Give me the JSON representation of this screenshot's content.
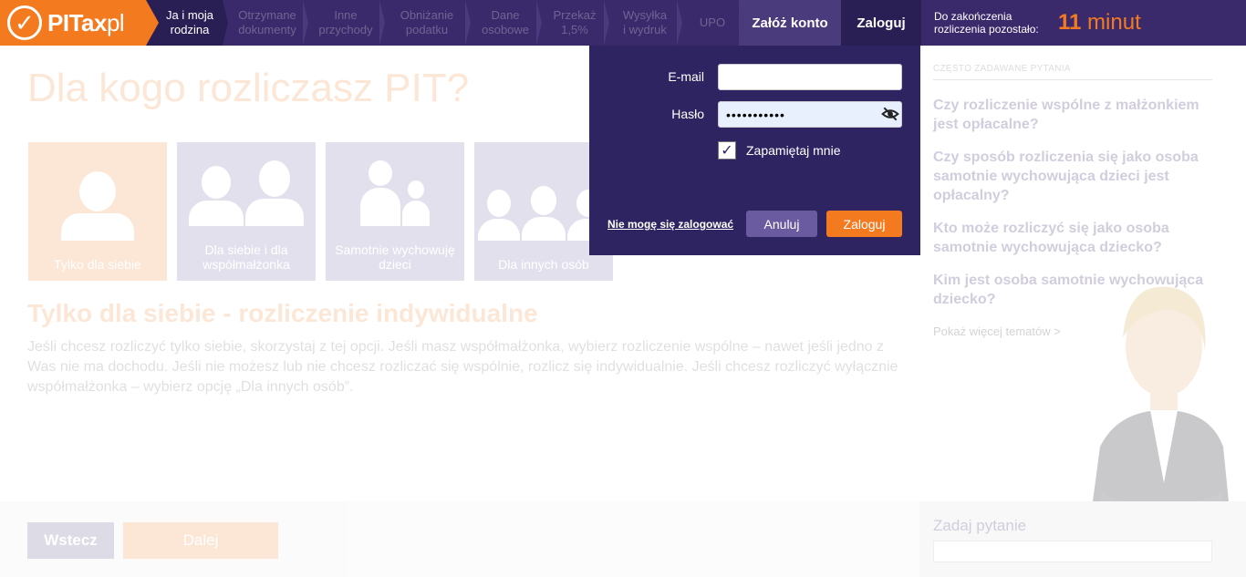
{
  "brand": {
    "name": "PITax",
    "suffix": "pl",
    "accent": "#f47a20",
    "primary": "#3b2a6b"
  },
  "nav": {
    "steps": [
      {
        "label": "Ja i moja rodzina",
        "active": true
      },
      {
        "label": "Otrzymane dokumenty"
      },
      {
        "label": "Inne przychody"
      },
      {
        "label": "Obniżanie podatku"
      },
      {
        "label": "Dane osobowe"
      },
      {
        "label": "Przekaż 1,5%"
      },
      {
        "label": "Wysyłka i wydruk"
      },
      {
        "label": "UPO"
      }
    ],
    "register_label": "Załóż konto",
    "login_label": "Zaloguj",
    "timer_label": "Do zakończenia rozliczenia pozostało:",
    "timer_value": "11",
    "timer_unit": "minut"
  },
  "main": {
    "title": "Dla kogo rozliczasz PIT?",
    "options": [
      {
        "label": "Tylko dla siebie",
        "icon": "single-person-icon",
        "selected": true
      },
      {
        "label": "Dla siebie i dla współmałżonka",
        "icon": "couple-icon"
      },
      {
        "label": "Samotnie wychowuję dzieci",
        "icon": "parent-child-icon"
      },
      {
        "label": "Dla innych osób",
        "icon": "group-icon"
      }
    ],
    "section_title": "Tylko dla siebie - rozliczenie indywidualne",
    "description": "Jeśli chcesz rozliczyć tylko siebie, skorzystaj z tej opcji. Jeśli masz współmałżonka, wybierz rozliczenie wspólne – nawet jeśli jedno z Was nie ma dochodu. Jeśli nie możesz lub nie chcesz rozliczać się wspólnie, rozlicz się indywidualnie. Jeśli chcesz rozliczyć wyłącznie współmałżonka – wybierz opcję „Dla innych osób”.",
    "back_label": "Wstecz",
    "next_label": "Dalej"
  },
  "sidebar": {
    "faq_heading": "Często zadawane pytania",
    "faq": [
      "Czy rozliczenie wspólne z małżonkiem jest opłacalne?",
      "Czy sposób rozliczenia się jako osoba samotnie wychowująca dzieci jest opłacalny?",
      "Kto może rozliczyć się jako osoba samotnie wychowująca dziecko?",
      "Kim jest osoba samotnie wychowująca dziecko?"
    ],
    "more_label": "Pokaż więcej tematów >",
    "ask_title": "Zadaj pytanie",
    "ask_value": ""
  },
  "login": {
    "email_label": "E-mail",
    "email_value": "",
    "password_label": "Hasło",
    "password_value": "•••••••••••",
    "remember_label": "Zapamiętaj mnie",
    "remember_checked": true,
    "forgot_label": "Nie mogę się zalogować",
    "cancel_label": "Anuluj",
    "submit_label": "Zaloguj"
  }
}
